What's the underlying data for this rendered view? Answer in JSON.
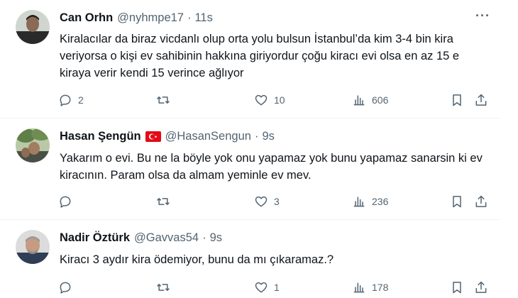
{
  "tweets": [
    {
      "name": "Can Orhn",
      "handle": "@nyhmpe17",
      "separator": "·",
      "time": "11s",
      "text": "Kiralacılar da biraz vicdanlı olup orta yolu bulsun İstanbul’da kim 3-4 bin kira veriyorsa o kişi ev sahibinin hakkına giriyordur çoğu kiracı evi olsa en az 15 e kiraya verir kendi 15 verince ağlıyor",
      "replies": "2",
      "retweets": "",
      "likes": "10",
      "views": "606",
      "more": "···"
    },
    {
      "name": "Hasan Şengün",
      "handle": "@HasanSengun",
      "separator": "·",
      "time": "9s",
      "text": "Yakarım o evi. Bu ne la böyle yok onu yapamaz yok bunu yapamaz sanarsin ki ev kiracının. Param olsa da almam yeminle ev mev.",
      "replies": "",
      "retweets": "",
      "likes": "3",
      "views": "236",
      "more": "···"
    },
    {
      "name": "Nadir Öztürk",
      "handle": "@Gavvas54",
      "separator": "·",
      "time": "9s",
      "text": "Kiracı 3 aydır kira ödemiyor, bunu da mı çıkaramaz.?",
      "replies": "",
      "retweets": "",
      "likes": "1",
      "views": "178",
      "more": "···"
    }
  ],
  "colors": {
    "text": "#0f1419",
    "secondary": "#536471",
    "divider": "#eff3f4",
    "flag_red": "#e30a17"
  },
  "icons": [
    "reply-icon",
    "retweet-icon",
    "like-icon",
    "views-icon",
    "bookmark-icon",
    "share-icon",
    "more-icon",
    "turkish-flag-icon"
  ]
}
